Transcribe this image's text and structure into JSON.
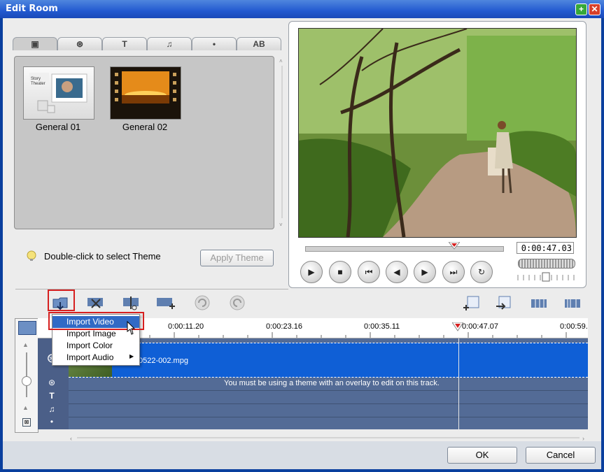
{
  "window": {
    "title": "Edit Room"
  },
  "theme_panel": {
    "themes": [
      {
        "label": "General 01"
      },
      {
        "label": "General 02"
      }
    ],
    "hint": "Double-click to select Theme",
    "apply_button": "Apply Theme"
  },
  "preview": {
    "timecode": "0:00:47.03"
  },
  "timeline": {
    "ruler_labels": [
      "0:00:11.20",
      "0:00:23.16",
      "0:00:35.11",
      "0:00:47.07",
      "0:00:59."
    ],
    "video_clip": "0522-002.mpg",
    "overlay_message": "You must be using a theme with an overlay to edit on this track."
  },
  "context_menu": {
    "items": [
      "Import Video",
      "Import Image",
      "Import Color",
      "Import Audio"
    ],
    "selected": "Import Video"
  },
  "footer": {
    "ok": "OK",
    "cancel": "Cancel"
  },
  "colors": {
    "accent": "#316ac5",
    "highlight": "#d62020",
    "track": "#0f5fd6"
  }
}
